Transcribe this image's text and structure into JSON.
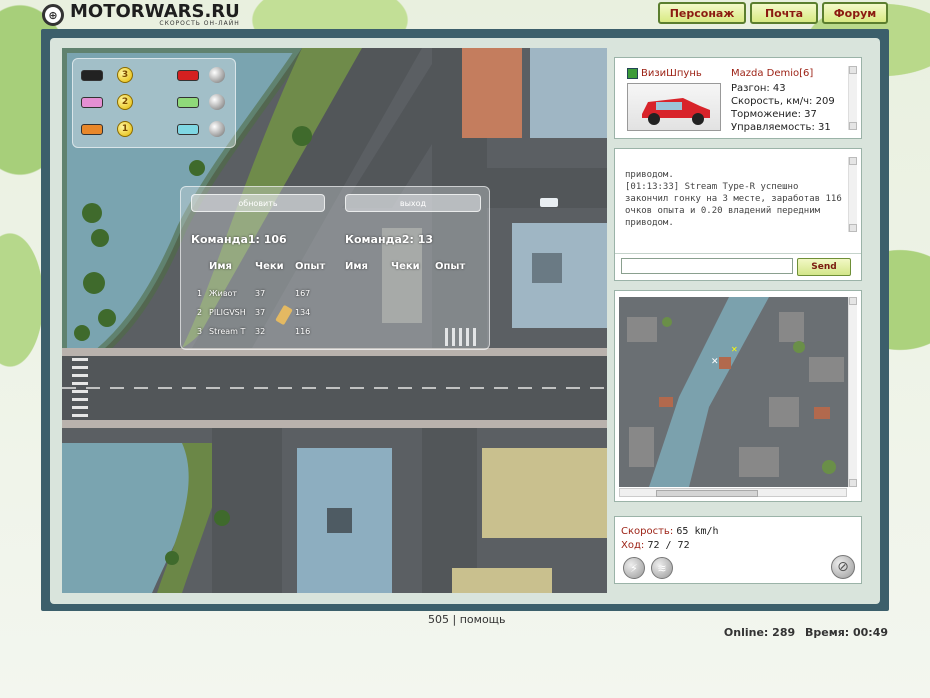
{
  "brand": {
    "title": "MOTORWARS.RU",
    "subtitle": "СКОРОСТЬ ОН-ЛАЙН",
    "icon": "steering-wheel-icon"
  },
  "nav": [
    "Персонаж",
    "Почта",
    "Форум"
  ],
  "player": {
    "name": "ВизиШпунь",
    "car": "Mazda Demio[6]",
    "stats": [
      "Разгон: 43",
      "Скорость, км/ч: 209",
      "Торможение: 37",
      "Управляемость: 31"
    ]
  },
  "chat": {
    "lines": [
      "приводом.",
      "[01:13:33] Stream Type-R успешно",
      "закончил гонку на 3 месте, заработав 116",
      "очков опыта и 0.20 владений передним",
      "приводом."
    ],
    "input_value": "",
    "send_label": "Send"
  },
  "speedpanel": {
    "speed_label": "Скорость:",
    "speed_value": "65 km/h",
    "turn_label": "Ход:",
    "turn_value": "72 / 72"
  },
  "overlay": {
    "refresh_label": "обновить",
    "exit_label": "выход",
    "team1": "Команда1:  106",
    "team2": "Команда2:  13",
    "headers_left": [
      "Имя",
      "Чеки",
      "Опыт"
    ],
    "headers_right": [
      "Имя",
      "Чеки",
      "Опыт"
    ],
    "rows": [
      {
        "n": "1",
        "name": "Живот",
        "checks": "37",
        "exp": "167"
      },
      {
        "n": "2",
        "name": "PILIGVSH",
        "checks": "37",
        "exp": "134"
      },
      {
        "n": "3",
        "name": "Stream T",
        "checks": "32",
        "exp": "116"
      }
    ]
  },
  "legend": {
    "left": [
      {
        "color": "#222222",
        "place": "3"
      },
      {
        "color": "#e58fd3",
        "place": "2"
      },
      {
        "color": "#e8872a",
        "place": "1"
      }
    ],
    "right": [
      {
        "color": "#d42020"
      },
      {
        "color": "#8fd97a"
      },
      {
        "color": "#7fd7e3"
      }
    ]
  },
  "footer": {
    "count": "505",
    "sep": "|",
    "help": "помощь"
  },
  "status": {
    "online": "Online: 289",
    "time": "Время: 00:49"
  }
}
